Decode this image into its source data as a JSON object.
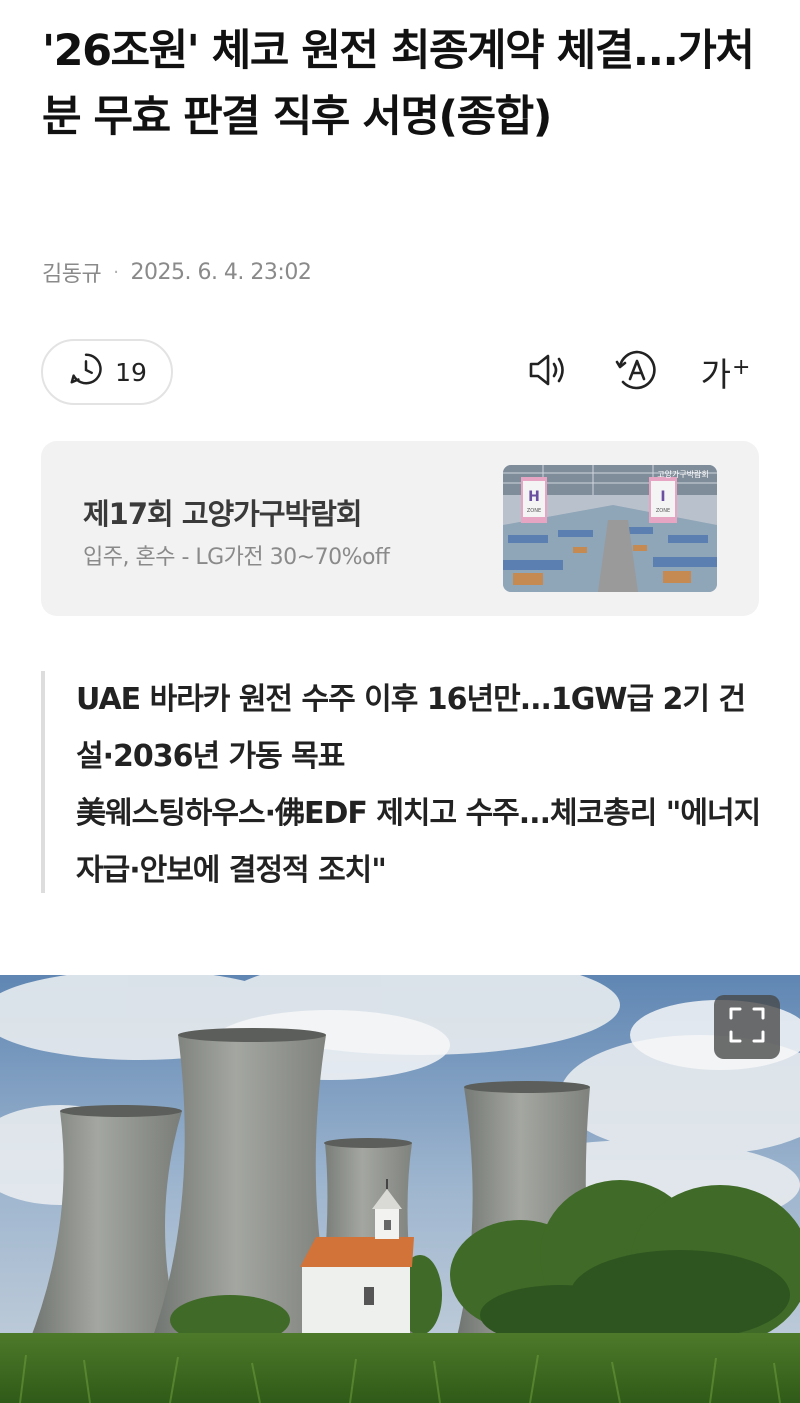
{
  "article": {
    "title": "'26조원' 체코 원전 최종계약 체결...가처분 무효 판결 직후 서명(종합)",
    "author": "김동규",
    "separator": "·",
    "timestamp": "2025. 6. 4. 23:02"
  },
  "toolbar": {
    "comment_count": "19",
    "font_size_label": "가",
    "font_size_plus": "+",
    "icons": [
      "clock-comment-icon",
      "speaker-icon",
      "translate-icon",
      "font-size-icon"
    ]
  },
  "ad": {
    "title": "제17회 고양가구박람회",
    "subtitle": "입주, 혼수 - LG가전 30~70%off",
    "thumb_logo": "고양가구박람회",
    "zone_left": "H",
    "zone_right": "I",
    "zone_word": "ZONE"
  },
  "summary": [
    "UAE 바라카 원전 수주 이후 16년만...1GW급 2기 건설·2036년 가동 목표",
    "美웨스팅하우스·佛EDF 제치고 수주...체코총리 \"에너지자급·안보에 결정적 조치\""
  ],
  "photo": {
    "subject": "cooling towers and chapel",
    "icon": "expand-icon"
  },
  "colors": {
    "text": "#111111",
    "muted": "#8a8a8a",
    "ad_bg": "#f2f2f2",
    "quote_bar": "#dddddd"
  }
}
